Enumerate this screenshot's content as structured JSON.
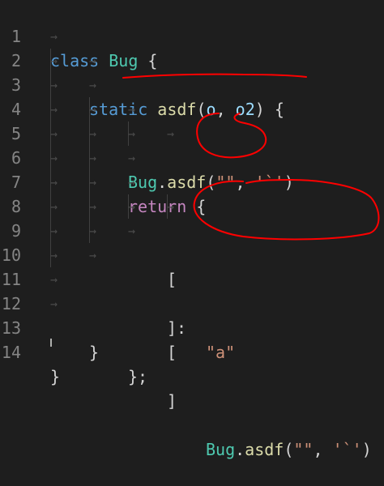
{
  "editor": {
    "lines": [
      {
        "num": "1",
        "tokens": [
          "class",
          " ",
          "Bug",
          " {"
        ]
      },
      {
        "num": "2",
        "tokens": [
          "static",
          " ",
          "asdf",
          "(",
          "o",
          ", ",
          "o2",
          ") {"
        ]
      },
      {
        "num": "3",
        "tokens": [
          "Bug",
          ".",
          "asdf",
          "(",
          "\"\"",
          ", ",
          "'`'",
          ")"
        ]
      },
      {
        "num": "4",
        "tokens": [
          "return",
          " {"
        ]
      },
      {
        "num": "5",
        "tokens": [
          "["
        ]
      },
      {
        "num": "6",
        "tokens": [
          "\"a\""
        ]
      },
      {
        "num": "7",
        "tokens": [
          "]:"
        ]
      },
      {
        "num": "8",
        "tokens": [
          "["
        ]
      },
      {
        "num": "9",
        "tokens": [
          "Bug",
          ".",
          "asdf",
          "(",
          "\"\"",
          ", ",
          "'`'",
          ")"
        ]
      },
      {
        "num": "10",
        "tokens": [
          "]"
        ]
      },
      {
        "num": "11",
        "tokens": [
          "};"
        ]
      },
      {
        "num": "12",
        "tokens": [
          "}"
        ]
      },
      {
        "num": "13",
        "tokens": [
          ""
        ]
      },
      {
        "num": "14",
        "tokens": [
          "}"
        ]
      }
    ],
    "tab_glyph": "→",
    "colors": {
      "background": "#1e1e1e",
      "line_number": "#858585",
      "keyword": "#569cd6",
      "class_name": "#4ec9b0",
      "function": "#dcdcaa",
      "parameter": "#9cdcfe",
      "string": "#ce9178",
      "control_keyword": "#c586c0",
      "annotation": "#ff0000"
    }
  }
}
